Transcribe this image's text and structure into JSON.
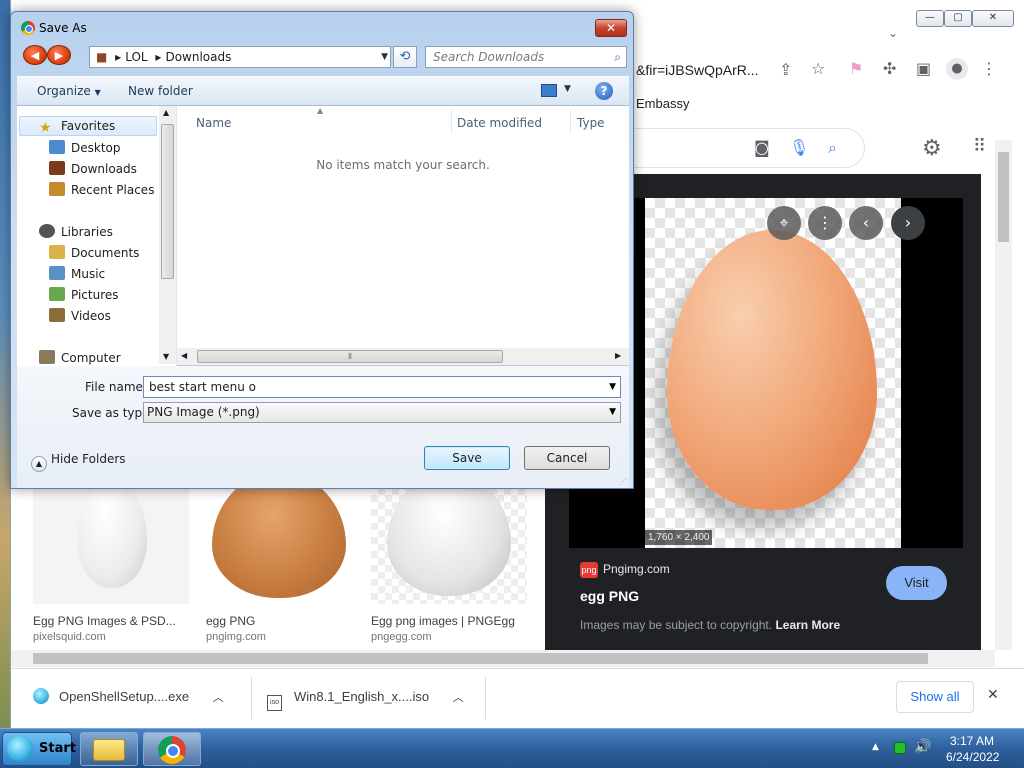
{
  "dialog": {
    "title": "Save As",
    "close_icon": "✕",
    "address": {
      "root_icon": "folder-icon",
      "segments": [
        "LOL",
        "Downloads"
      ]
    },
    "search_placeholder": "Search Downloads",
    "toolbar": {
      "organize": "Organize",
      "new_folder": "New folder",
      "help": "?"
    },
    "nav": {
      "favorites": "Favorites",
      "desktop": "Desktop",
      "downloads": "Downloads",
      "recent_places": "Recent Places",
      "libraries": "Libraries",
      "documents": "Documents",
      "music": "Music",
      "pictures": "Pictures",
      "videos": "Videos",
      "computer": "Computer"
    },
    "columns": {
      "name": "Name",
      "date_modified": "Date modified",
      "type": "Type"
    },
    "empty_message": "No items match your search.",
    "file_name_label": "File name:",
    "file_name_value": "best start menu o",
    "save_type_label": "Save as type:",
    "save_type_value": "PNG Image (*.png)",
    "hide_folders": "Hide Folders",
    "save_button": "Save",
    "cancel_button": "Cancel"
  },
  "browser": {
    "url_fragment": "&fir=iJBSwQpArR...",
    "bookmark": "Embassy",
    "preview": {
      "dimensions": "1,760 × 2,400",
      "source": "Pngimg.com",
      "source_logo": "png",
      "title": "egg PNG",
      "visit": "Visit",
      "copyright_text": "Images may be subject to copyright.",
      "learn_more": "Learn More"
    },
    "results": [
      {
        "title": "Egg PNG Images & PSD...",
        "source": "pixelsquid.com"
      },
      {
        "title": "egg PNG",
        "source": "pngimg.com"
      },
      {
        "title": "Egg png images | PNGEgg",
        "source": "pngegg.com"
      }
    ],
    "downloads": [
      {
        "name": "OpenShellSetup....exe"
      },
      {
        "name": "Win8.1_English_x....iso"
      }
    ],
    "show_all": "Show all"
  },
  "taskbar": {
    "start": "Start",
    "clock_time": "3:17 AM",
    "clock_date": "6/24/2022"
  }
}
